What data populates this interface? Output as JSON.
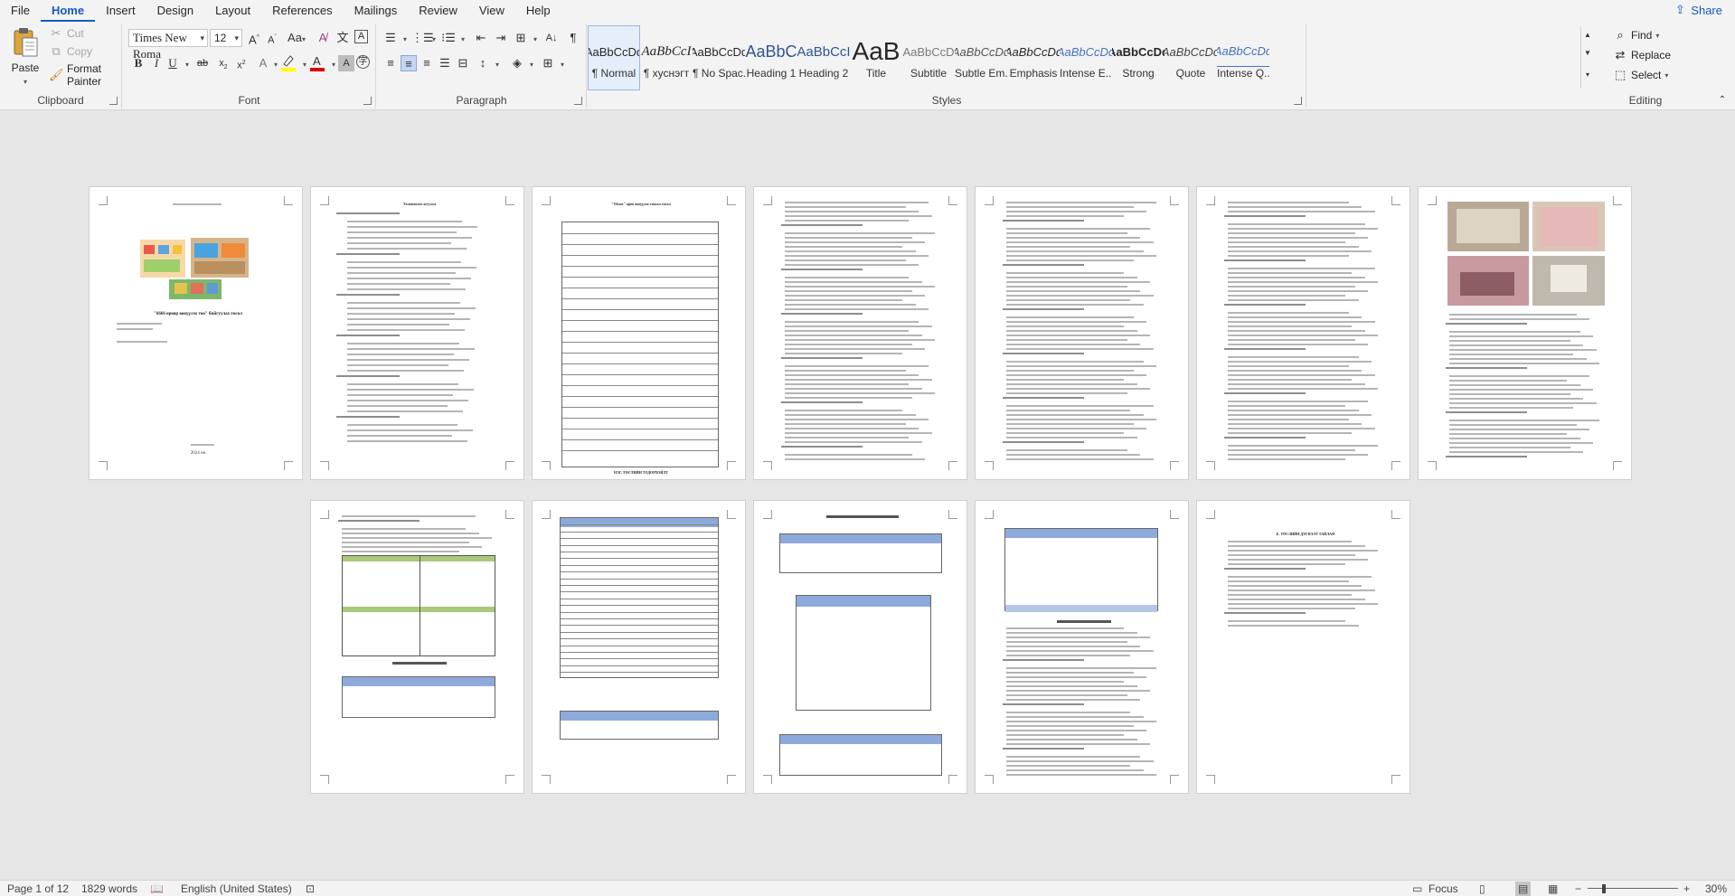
{
  "menu": {
    "items": [
      "File",
      "Home",
      "Insert",
      "Design",
      "Layout",
      "References",
      "Mailings",
      "Review",
      "View",
      "Help"
    ],
    "active": "Home",
    "share": "Share"
  },
  "clipboard": {
    "label": "Clipboard",
    "paste": "Paste",
    "cut": "Cut",
    "copy": "Copy",
    "format_painter": "Format Painter"
  },
  "font": {
    "label": "Font",
    "family": "Times New Roma",
    "size": "12",
    "highlight_color": "#ffff00",
    "font_color": "#e00000"
  },
  "paragraph": {
    "label": "Paragraph"
  },
  "styles": {
    "label": "Styles",
    "items": [
      {
        "preview": "AaBbCcDd",
        "name": "¶ Normal"
      },
      {
        "preview": "AaBbCcI",
        "name": "¶ хуснэгт"
      },
      {
        "preview": "AaBbCcDd",
        "name": "¶ No Spac..."
      },
      {
        "preview": "AaBbC",
        "name": "Heading 1"
      },
      {
        "preview": "AaBbCcI",
        "name": "Heading 2"
      },
      {
        "preview": "AaB",
        "name": "Title"
      },
      {
        "preview": "AaBbCcD",
        "name": "Subtitle"
      },
      {
        "preview": "AaBbCcDd",
        "name": "Subtle Em..."
      },
      {
        "preview": "AaBbCcDd",
        "name": "Emphasis"
      },
      {
        "preview": "AaBbCcDd",
        "name": "Intense E..."
      },
      {
        "preview": "AaBbCcDd",
        "name": "Strong"
      },
      {
        "preview": "AaBbCcDd",
        "name": "Quote"
      },
      {
        "preview": "AaBbCcDd",
        "name": "Intense Q..."
      }
    ]
  },
  "editing": {
    "label": "Editing",
    "find": "Find",
    "replace": "Replace",
    "select": "Select"
  },
  "pages": {
    "p1_title": "\"6666 өрөөр өөөүүлэх төө\" бийгуулах төсөл",
    "p1_year": "2024 он",
    "p2_heading": "Төлөвлөлөх агуулга",
    "p3_heading": "\"Үйлэх\" өрөө өөөүүлэх төөсөл төсөл",
    "p3_section": "НЭГ. ТӨСЛИЙН ТОДОРХОЙЛТ",
    "p12_heading": "Б. ТӨСЛИЙН ДҮГНЭЛТ ТАЙЛАН"
  },
  "status": {
    "page": "Page 1 of 12",
    "words": "1829 words",
    "language": "English (United States)",
    "focus": "Focus",
    "zoom": "30%"
  }
}
